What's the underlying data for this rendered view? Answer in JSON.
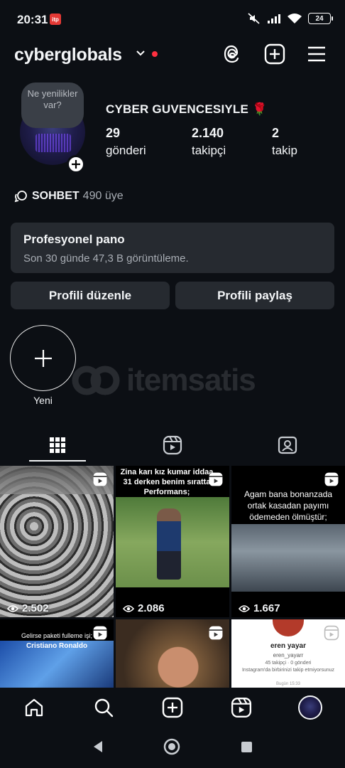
{
  "status": {
    "time": "20:31",
    "badge": "itp",
    "battery": "24"
  },
  "header": {
    "username": "cyberglobals"
  },
  "profile": {
    "note": "Ne yenilikler var?",
    "display_name": "CYBER GUVENCESIYLE 🌹",
    "stats": [
      {
        "value": "29",
        "label": "gönderi"
      },
      {
        "value": "2.140",
        "label": "takipçi"
      },
      {
        "value": "2",
        "label": "takip"
      }
    ],
    "channel": {
      "name": "SOHBET",
      "members": "490 üye"
    }
  },
  "dashboard": {
    "title": "Profesyonel pano",
    "subtitle": "Son 30 günde 47,3 B görüntüleme."
  },
  "buttons": {
    "edit": "Profili düzenle",
    "share": "Profili paylaş"
  },
  "highlight": {
    "new_label": "Yeni"
  },
  "watermark": {
    "text": "itemsatis"
  },
  "grid": {
    "posts": [
      {
        "views": "2.502",
        "caption": ""
      },
      {
        "views": "2.086",
        "caption": "Zina karı kız kumar iddaa 31 derken benim sıratta Performans;"
      },
      {
        "views": "1.667",
        "caption": "Agam bana bonanzada ortak kasadan payımı ödemeden ölmüştür;"
      },
      {
        "views": "",
        "caption": "Gelirse paketi fulleme işi;",
        "subcaption": "Cristiano Ronaldo"
      },
      {
        "views": "",
        "caption": ""
      },
      {
        "views": "",
        "caption": "",
        "card": {
          "name": "eren yayar",
          "handle": "eren_yayarr",
          "meta": "45 takipçi · 0 gönderi",
          "note": "Instagram'da birbirinizi takip etmiyorsunuz",
          "time": "Bugün 15:33"
        }
      }
    ]
  },
  "colors": {
    "background": "#0c0f14",
    "card": "#262a30",
    "accent_red": "#ff3040"
  }
}
